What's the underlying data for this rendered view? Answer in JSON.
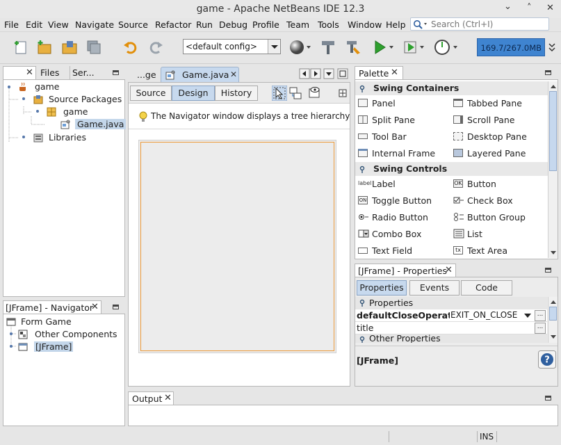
{
  "window": {
    "title": "game - Apache NetBeans IDE 12.3",
    "controls": [
      "⌄",
      "˄",
      "✕"
    ]
  },
  "menu": [
    "File",
    "Edit",
    "View",
    "Navigate",
    "Source",
    "Refactor",
    "Run",
    "Debug",
    "Profile",
    "Team",
    "Tools",
    "Window",
    "Help"
  ],
  "search": {
    "placeholder": "Search (Ctrl+I)"
  },
  "toolbar": {
    "config": "<default config>",
    "memory": "169.7/267.0MB"
  },
  "projects": {
    "tabs": [
      "Files",
      "Ser..."
    ],
    "tree": [
      {
        "label": "game"
      },
      {
        "label": "Source Packages"
      },
      {
        "label": "game"
      },
      {
        "label": "Game.java"
      },
      {
        "label": "Libraries"
      }
    ]
  },
  "navigator": {
    "title": "[JFrame] - Navigator",
    "tree": [
      {
        "label": "Form Game"
      },
      {
        "label": "Other Components"
      },
      {
        "label": "[JFrame]"
      }
    ]
  },
  "editor": {
    "tabs": [
      "...ge",
      "Game.java"
    ],
    "views": [
      "Source",
      "Design",
      "History"
    ],
    "hint": "The Navigator window displays a tree hierarchy of"
  },
  "palette": {
    "title": "Palette",
    "sections": [
      {
        "title": "Swing Containers",
        "items": [
          "Panel",
          "Tabbed Pane",
          "Split Pane",
          "Scroll Pane",
          "Tool Bar",
          "Desktop Pane",
          "Internal Frame",
          "Layered Pane"
        ]
      },
      {
        "title": "Swing Controls",
        "items": [
          "Label",
          "Button",
          "Toggle Button",
          "Check Box",
          "Radio Button",
          "Button Group",
          "Combo Box",
          "List",
          "Text Field",
          "Text Area"
        ]
      }
    ],
    "icon_text": {
      "label": "label",
      "button": "OK",
      "toggle": "ON",
      "textarea": "tx"
    }
  },
  "properties": {
    "title": "[JFrame] - Properties",
    "tabs": [
      "Properties",
      "Events",
      "Code"
    ],
    "section": "Properties",
    "rows": [
      {
        "name": "defaultCloseOperatic",
        "value": "EXIT_ON_CLOSE"
      },
      {
        "name": "title",
        "value": ""
      }
    ],
    "other": "Other Properties",
    "footer": "[JFrame]",
    "ellipsis": "..."
  },
  "output": {
    "title": "Output"
  },
  "status": {
    "mode": "INS"
  },
  "colors": {
    "accent": "#3f84d0",
    "selection": "#c3d6ea"
  }
}
